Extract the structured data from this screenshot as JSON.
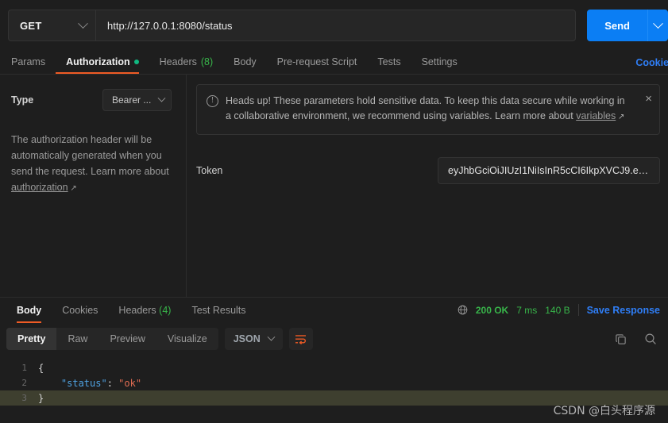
{
  "request": {
    "method": "GET",
    "url": "http://127.0.0.1:8080/status",
    "send_label": "Send",
    "tabs": [
      {
        "label": "Params",
        "active": false,
        "badge": "",
        "dot": false
      },
      {
        "label": "Authorization",
        "active": true,
        "badge": "",
        "dot": true
      },
      {
        "label": "Headers",
        "active": false,
        "badge": "(8)",
        "dot": false
      },
      {
        "label": "Body",
        "active": false,
        "badge": "",
        "dot": false
      },
      {
        "label": "Pre-request Script",
        "active": false,
        "badge": "",
        "dot": false
      },
      {
        "label": "Tests",
        "active": false,
        "badge": "",
        "dot": false
      },
      {
        "label": "Settings",
        "active": false,
        "badge": "",
        "dot": false
      }
    ],
    "cookies_link": "Cookies"
  },
  "authorization": {
    "type_label": "Type",
    "type_value": "Bearer ...",
    "help_text": "The authorization header will be automatically generated when you send the request. Learn more about ",
    "help_link": "authorization",
    "banner": {
      "text": "Heads up! These parameters hold sensitive data. To keep this data secure while working in a collaborative environment, we recommend using variables. Learn more about ",
      "link": "variables",
      "close": "×",
      "icon": "info-icon"
    },
    "token_label": "Token",
    "token_value": "eyJhbGciOiJIUzI1NiIsInR5cCI6IkpXVCJ9.ey...."
  },
  "response": {
    "tabs": [
      {
        "label": "Body",
        "active": true,
        "badge": ""
      },
      {
        "label": "Cookies",
        "active": false,
        "badge": ""
      },
      {
        "label": "Headers",
        "active": false,
        "badge": "(4)"
      },
      {
        "label": "Test Results",
        "active": false,
        "badge": ""
      }
    ],
    "status": "200 OK",
    "time": "7 ms",
    "size": "140 B",
    "save_label": "Save Response",
    "formats": [
      {
        "label": "Pretty",
        "active": true
      },
      {
        "label": "Raw",
        "active": false
      },
      {
        "label": "Preview",
        "active": false
      },
      {
        "label": "Visualize",
        "active": false
      }
    ],
    "language": "JSON",
    "code_lines": [
      {
        "num": "1",
        "open_brace": "{",
        "key": "",
        "colon": "",
        "value": "",
        "close_brace": "",
        "highlight": false
      },
      {
        "num": "2",
        "open_brace": "",
        "key": "\"status\"",
        "colon": ": ",
        "value": "\"ok\"",
        "close_brace": "",
        "highlight": false
      },
      {
        "num": "3",
        "open_brace": "",
        "key": "",
        "colon": "",
        "value": "",
        "close_brace": "}",
        "highlight": true
      }
    ]
  },
  "watermark": "CSDN @白头程序源",
  "colors": {
    "accent_orange": "#ef5b25",
    "link_blue": "#2f7ef6",
    "send_blue": "#0b7ef4",
    "status_green": "#38b54a",
    "background": "#1e1e1e"
  }
}
